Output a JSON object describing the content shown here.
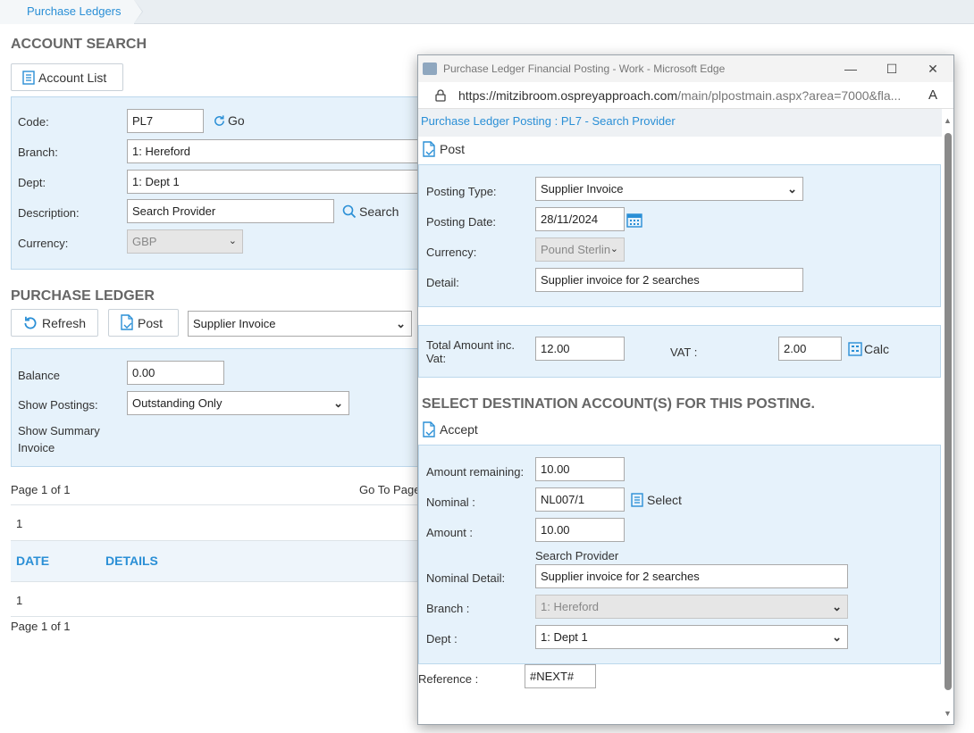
{
  "breadcrumb": "Purchase Ledgers",
  "account_search": {
    "title": "ACCOUNT SEARCH",
    "account_list_label": "Account List",
    "code_label": "Code:",
    "code_value": "PL7",
    "go_label": "Go",
    "branch_label": "Branch:",
    "branch_value": "1: Hereford",
    "dept_label": "Dept:",
    "dept_value": "1: Dept 1",
    "description_label": "Description:",
    "description_value": "Search Provider",
    "search_label": "Search",
    "currency_label": "Currency:",
    "currency_value": "GBP"
  },
  "purchase_ledger": {
    "title": "PURCHASE LEDGER",
    "refresh_label": "Refresh",
    "post_label": "Post",
    "posting_type_value": "Supplier Invoice",
    "balance_label": "Balance",
    "balance_value": "0.00",
    "show_postings_label": "Show Postings:",
    "show_postings_value": "Outstanding Only",
    "show_summary_label": "Show Summary Invoice",
    "page_info_top": "Page 1 of 1",
    "go_to_page_label": "Go To Page",
    "pager_number_top": "1",
    "col_date": "DATE",
    "col_details": "DETAILS",
    "pager_number_bottom": "1",
    "page_info_bottom": "Page 1 of 1"
  },
  "popup": {
    "window_title": "Purchase Ledger Financial Posting - Work - Microsoft Edge",
    "url_domain": "https://mitzibroom.ospreyapproach.com",
    "url_path": "/main/plpostmain.aspx?area=7000&fla...",
    "reader_icon_text": "A",
    "subtitle": "Purchase Ledger Posting : PL7 - Search Provider",
    "post_label": "Post",
    "posting_type_label": "Posting Type:",
    "posting_type_value": "Supplier Invoice",
    "posting_date_label": "Posting Date:",
    "posting_date_value": "28/11/2024",
    "currency_label": "Currency:",
    "currency_value": "Pound Sterlin",
    "detail_label": "Detail:",
    "detail_value": "Supplier invoice for 2 searches",
    "total_amount_label_1": "Total Amount inc.",
    "total_amount_label_2": "Vat:",
    "total_amount_value": "12.00",
    "vat_label": "VAT :",
    "vat_value": "2.00",
    "calc_label": "Calc",
    "destination_title": "SELECT DESTINATION ACCOUNT(S) FOR THIS POSTING.",
    "accept_label": "Accept",
    "amount_remaining_label": "Amount remaining:",
    "amount_remaining_value": "10.00",
    "nominal_label": "Nominal :",
    "nominal_value": "NL007/1",
    "select_label": "Select",
    "amount_label": "Amount :",
    "amount_value": "10.00",
    "nominal_name": "Search Provider",
    "nominal_detail_label": "Nominal Detail:",
    "nominal_detail_value": "Supplier invoice for 2 searches",
    "branch_label": "Branch :",
    "branch_value": "1: Hereford",
    "dept_label": "Dept :",
    "dept_value": "1: Dept 1",
    "reference_label": "Reference :",
    "reference_value": "#NEXT#"
  },
  "colors": {
    "accent_blue": "#2a8fd6",
    "panel_bg": "#e6f2fb",
    "panel_border": "#bcd8ec"
  }
}
